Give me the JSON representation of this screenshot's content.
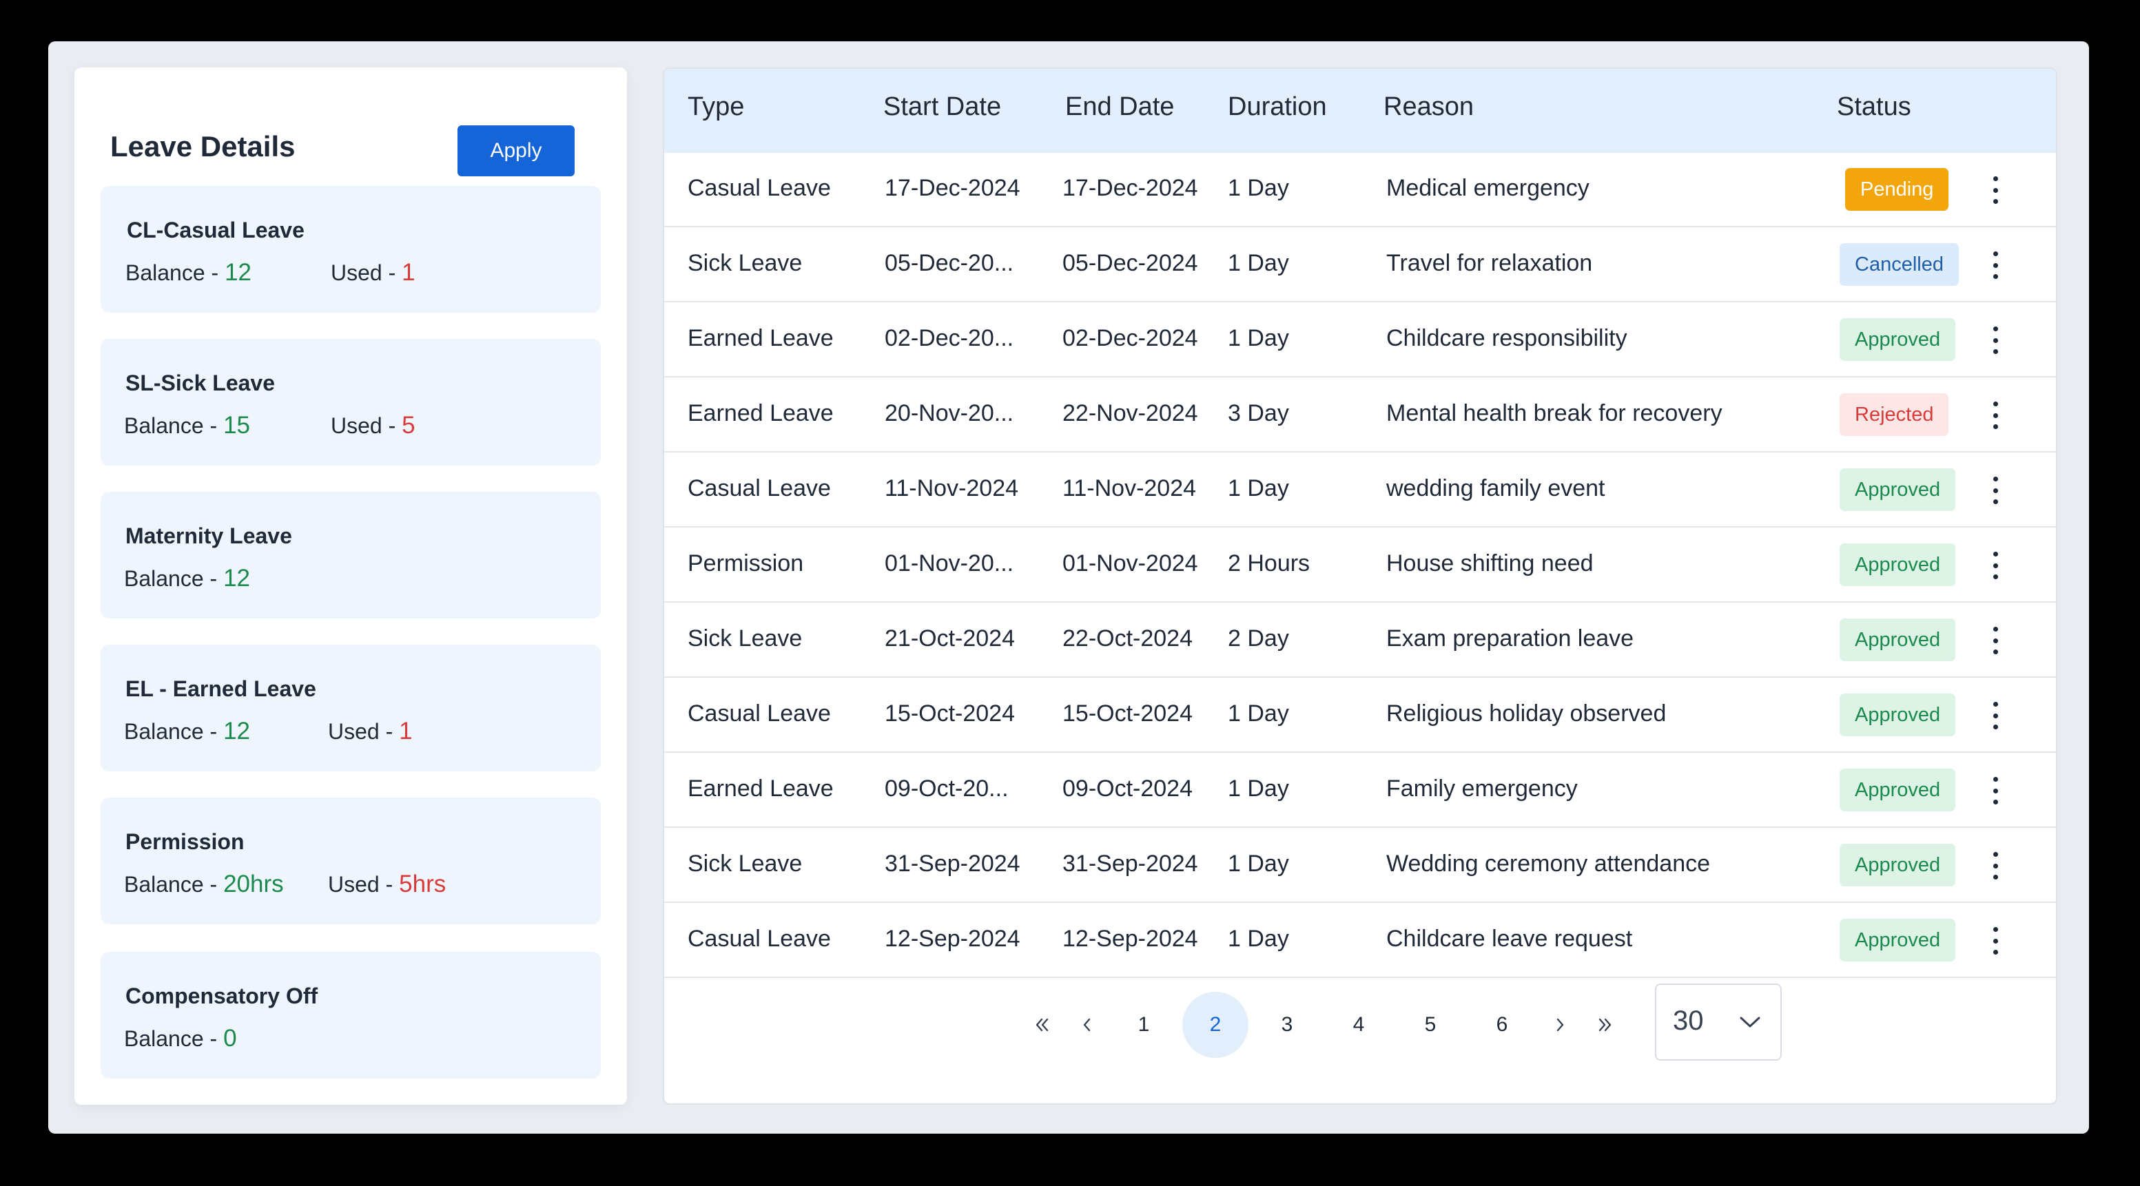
{
  "left_panel": {
    "title": "Leave Details",
    "apply_label": "Apply",
    "cards": [
      {
        "title": "CL-Casual Leave",
        "balance_label": "Balance - ",
        "balance": "12",
        "used_label": "Used - ",
        "used": "1"
      },
      {
        "title": "SL-Sick Leave",
        "balance_label": "Balance - ",
        "balance": "15",
        "used_label": "Used - ",
        "used": "5"
      },
      {
        "title": "Maternity Leave",
        "balance_label": "Balance - ",
        "balance": "12"
      },
      {
        "title": "EL - Earned Leave",
        "balance_label": "Balance - ",
        "balance": "12",
        "used_label": "Used - ",
        "used": "1"
      },
      {
        "title": "Permission",
        "balance_label": "Balance - ",
        "balance": "20hrs",
        "used_label": "Used - ",
        "used": "5hrs"
      },
      {
        "title": "Compensatory Off",
        "balance_label": "Balance - ",
        "balance": "0"
      }
    ]
  },
  "table": {
    "headers": [
      "Type",
      "Start Date",
      "End Date",
      "Duration",
      "Reason",
      "Status"
    ],
    "rows": [
      {
        "type": "Casual Leave",
        "start": "17-Dec-2024",
        "end": "17-Dec-2024",
        "duration": "1 Day",
        "reason": "Medical emergency",
        "status": "Pending"
      },
      {
        "type": "Sick Leave",
        "start": "05-Dec-20...",
        "end": "05-Dec-2024",
        "duration": "1 Day",
        "reason": "Travel for relaxation",
        "status": "Cancelled"
      },
      {
        "type": "Earned Leave",
        "start": "02-Dec-20...",
        "end": "02-Dec-2024",
        "duration": "1 Day",
        "reason": "Childcare responsibility",
        "status": "Approved"
      },
      {
        "type": "Earned Leave",
        "start": "20-Nov-20...",
        "end": "22-Nov-2024",
        "duration": "3 Day",
        "reason": "Mental health break for recovery",
        "status": "Rejected"
      },
      {
        "type": "Casual Leave",
        "start": "11-Nov-2024",
        "end": "11-Nov-2024",
        "duration": "1 Day",
        "reason": "wedding family event",
        "status": "Approved"
      },
      {
        "type": "Permission",
        "start": "01-Nov-20...",
        "end": "01-Nov-2024",
        "duration": "2 Hours",
        "reason": "House shifting need",
        "status": "Approved"
      },
      {
        "type": "Sick Leave",
        "start": "21-Oct-2024",
        "end": "22-Oct-2024",
        "duration": "2 Day",
        "reason": "Exam preparation leave",
        "status": "Approved"
      },
      {
        "type": "Casual Leave",
        "start": "15-Oct-2024",
        "end": "15-Oct-2024",
        "duration": "1 Day",
        "reason": "Religious holiday observed",
        "status": "Approved"
      },
      {
        "type": "Earned Leave",
        "start": "09-Oct-20...",
        "end": "09-Oct-2024",
        "duration": "1 Day",
        "reason": "Family emergency",
        "status": "Approved"
      },
      {
        "type": "Sick Leave",
        "start": "31-Sep-2024",
        "end": "31-Sep-2024",
        "duration": "1 Day",
        "reason": "Wedding ceremony attendance",
        "status": "Approved"
      },
      {
        "type": "Casual Leave",
        "start": "12-Sep-2024",
        "end": "12-Sep-2024",
        "duration": "1 Day",
        "reason": "Childcare leave request",
        "status": "Approved"
      }
    ]
  },
  "status_colors": {
    "Pending": {
      "bg": "#f2a60c",
      "fg": "#ffffff"
    },
    "Cancelled": {
      "bg": "#dcebfb",
      "fg": "#1f5fa8"
    },
    "Approved": {
      "bg": "#dcf3e6",
      "fg": "#1b8a4c"
    },
    "Rejected": {
      "bg": "#fde6e6",
      "fg": "#d93a3a"
    }
  },
  "pagination": {
    "first_icon": "chevrons-left-icon",
    "prev_icon": "chevron-left-icon",
    "pages": [
      "1",
      "2",
      "3",
      "4",
      "5",
      "6"
    ],
    "current": "2",
    "next_icon": "chevron-right-icon",
    "last_icon": "chevrons-right-icon",
    "page_size": "30"
  }
}
